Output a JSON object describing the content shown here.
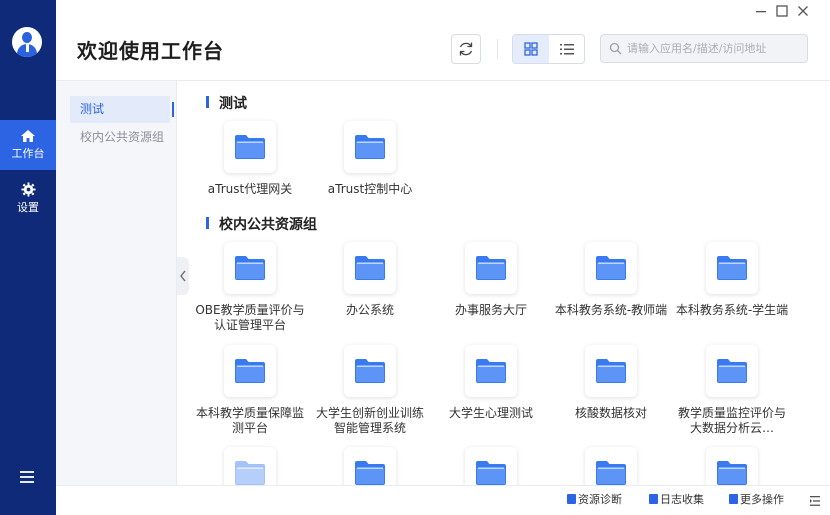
{
  "header": {
    "title": "欢迎使用工作台",
    "search_placeholder": "请输入应用名/描述/访问地址",
    "window_controls": [
      "minimize",
      "maximize",
      "close"
    ]
  },
  "nav": {
    "items": [
      {
        "label": "工作台",
        "icon": "home-icon",
        "active": true
      },
      {
        "label": "设置",
        "icon": "gear-icon",
        "active": false
      }
    ],
    "menu_icon": "hamburger-icon"
  },
  "groups": [
    {
      "label": "测试",
      "active": true
    },
    {
      "label": "校内公共资源组",
      "active": false
    }
  ],
  "sections": [
    {
      "title": "测试",
      "apps": [
        "aTrust代理网关",
        "aTrust控制中心"
      ]
    },
    {
      "title": "校内公共资源组",
      "apps": [
        "OBE教学质量评价与认证管理平台",
        "办公系统",
        "办事服务大厅",
        "本科教务系统-教师端",
        "本科教务系统-学生端",
        "本科教学质量保障监测平台",
        "大学生创新创业训练智能管理系统",
        "大学生心理测试",
        "核酸数据核对",
        "教学质量监控评价与大数据分析云…"
      ]
    }
  ],
  "footer": {
    "diagnose": "资源诊断",
    "logs": "日志收集",
    "more": "更多操作"
  },
  "colors": {
    "nav_bg": "#0f2a78",
    "accent": "#2d64e3",
    "folder": "#3a7af0"
  }
}
